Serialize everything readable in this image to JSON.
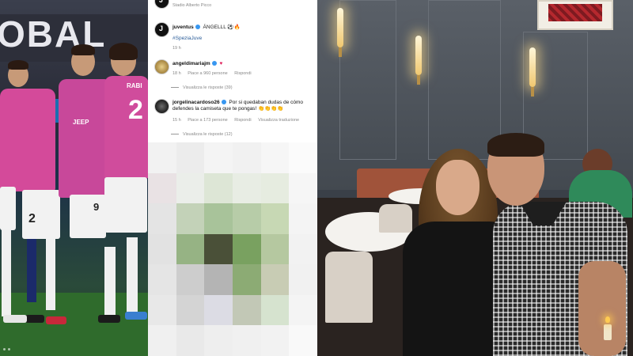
{
  "left_photo": {
    "banner_text": "OBAL",
    "player_numbers": [
      "2",
      "2",
      "9",
      "RABI"
    ],
    "badge_text": "JEEP"
  },
  "post": {
    "header_user": "juventus",
    "location": "Stadio Alberto Picco",
    "author": "juventus",
    "caption": "ÁNGELLL ⚽️🔥",
    "hashtag": "#SpeziaJuve",
    "time": "19 h"
  },
  "comments": [
    {
      "user": "angeldimariajm",
      "verified": true,
      "text": "♥",
      "time": "18 h",
      "likes": "Piace a 960 persone",
      "reply": "Rispondi",
      "view_replies": "Visualizza le risposte (39)"
    },
    {
      "user": "jorgelinacardoso26",
      "verified": true,
      "text": "Por si quedaban dudas de cómo defendes la camiseta que te pongas! 👏👏👏👏",
      "time": "15 h",
      "likes": "Piace a 173 persone",
      "reply": "Rispondi",
      "translate": "Visualizza traduzione",
      "view_replies": "Visualizza le risposte (12)"
    }
  ],
  "mosaic_colors": [
    "#f2f2f2",
    "#ececec",
    "#f4f4f4",
    "#f1f1f1",
    "#f6f6f6",
    "#fbfbfb",
    "#e9e2e4",
    "#ebeeea",
    "#dde6d6",
    "#e8ede4",
    "#e6ece0",
    "#f6f6f6",
    "#e4e4e4",
    "#c3d2b8",
    "#a8c39a",
    "#b7cca8",
    "#c7d8b4",
    "#f4f4f4",
    "#e2e2e2",
    "#96b384",
    "#4a5038",
    "#79a160",
    "#b5c8a0",
    "#f2f2f2",
    "#e5e5e5",
    "#cdcdcd",
    "#b4b4b4",
    "#8cab74",
    "#c8ccb4",
    "#f1f1f1",
    "#e8e8e8",
    "#d4d4d4",
    "#dcdce4",
    "#c2c8b6",
    "#d6e3cf",
    "#f4f4f4",
    "#f0f0f0",
    "#e9e9e9",
    "#eeeeee",
    "#f0f0f0",
    "#f2f2f2",
    "#f9f9f9"
  ]
}
